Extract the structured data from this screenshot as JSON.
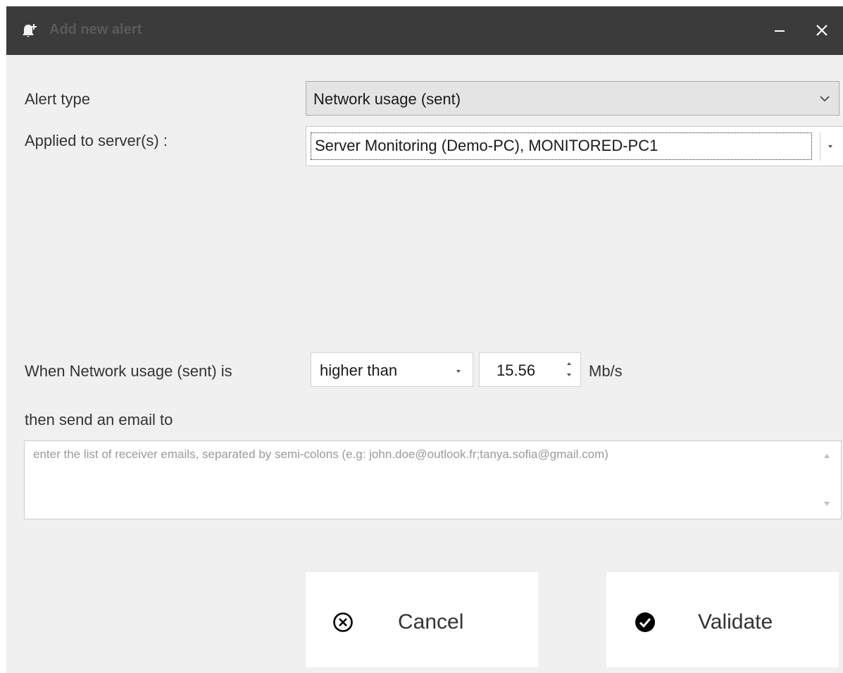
{
  "window": {
    "title": "Add new alert"
  },
  "titlebar_icons": {
    "app": "bell-plus-icon",
    "minimize": "minimize-icon",
    "close": "close-icon"
  },
  "form": {
    "alert_type_label": "Alert type",
    "alert_type_value": "Network usage (sent)",
    "servers_label": "Applied to server(s) :",
    "servers_value": "Server Monitoring (Demo-PC), MONITORED-PC1",
    "condition_prefix": "When Network usage (sent) is",
    "operator_value": "higher than",
    "threshold_value": "15.56",
    "unit": "Mb/s",
    "email_label": "then send an email to",
    "email_placeholder": "enter the list of receiver emails, separated by semi-colons (e.g: john.doe@outlook.fr;tanya.sofia@gmail.com)"
  },
  "buttons": {
    "cancel_label": "Cancel",
    "cancel_icon": "circle-x-icon",
    "validate_label": "Validate",
    "validate_icon": "circle-check-icon"
  },
  "colors": {
    "titlebar": "#3b3b3b",
    "background": "#f0f0f0",
    "combo_selected": "#e4e4e4"
  }
}
